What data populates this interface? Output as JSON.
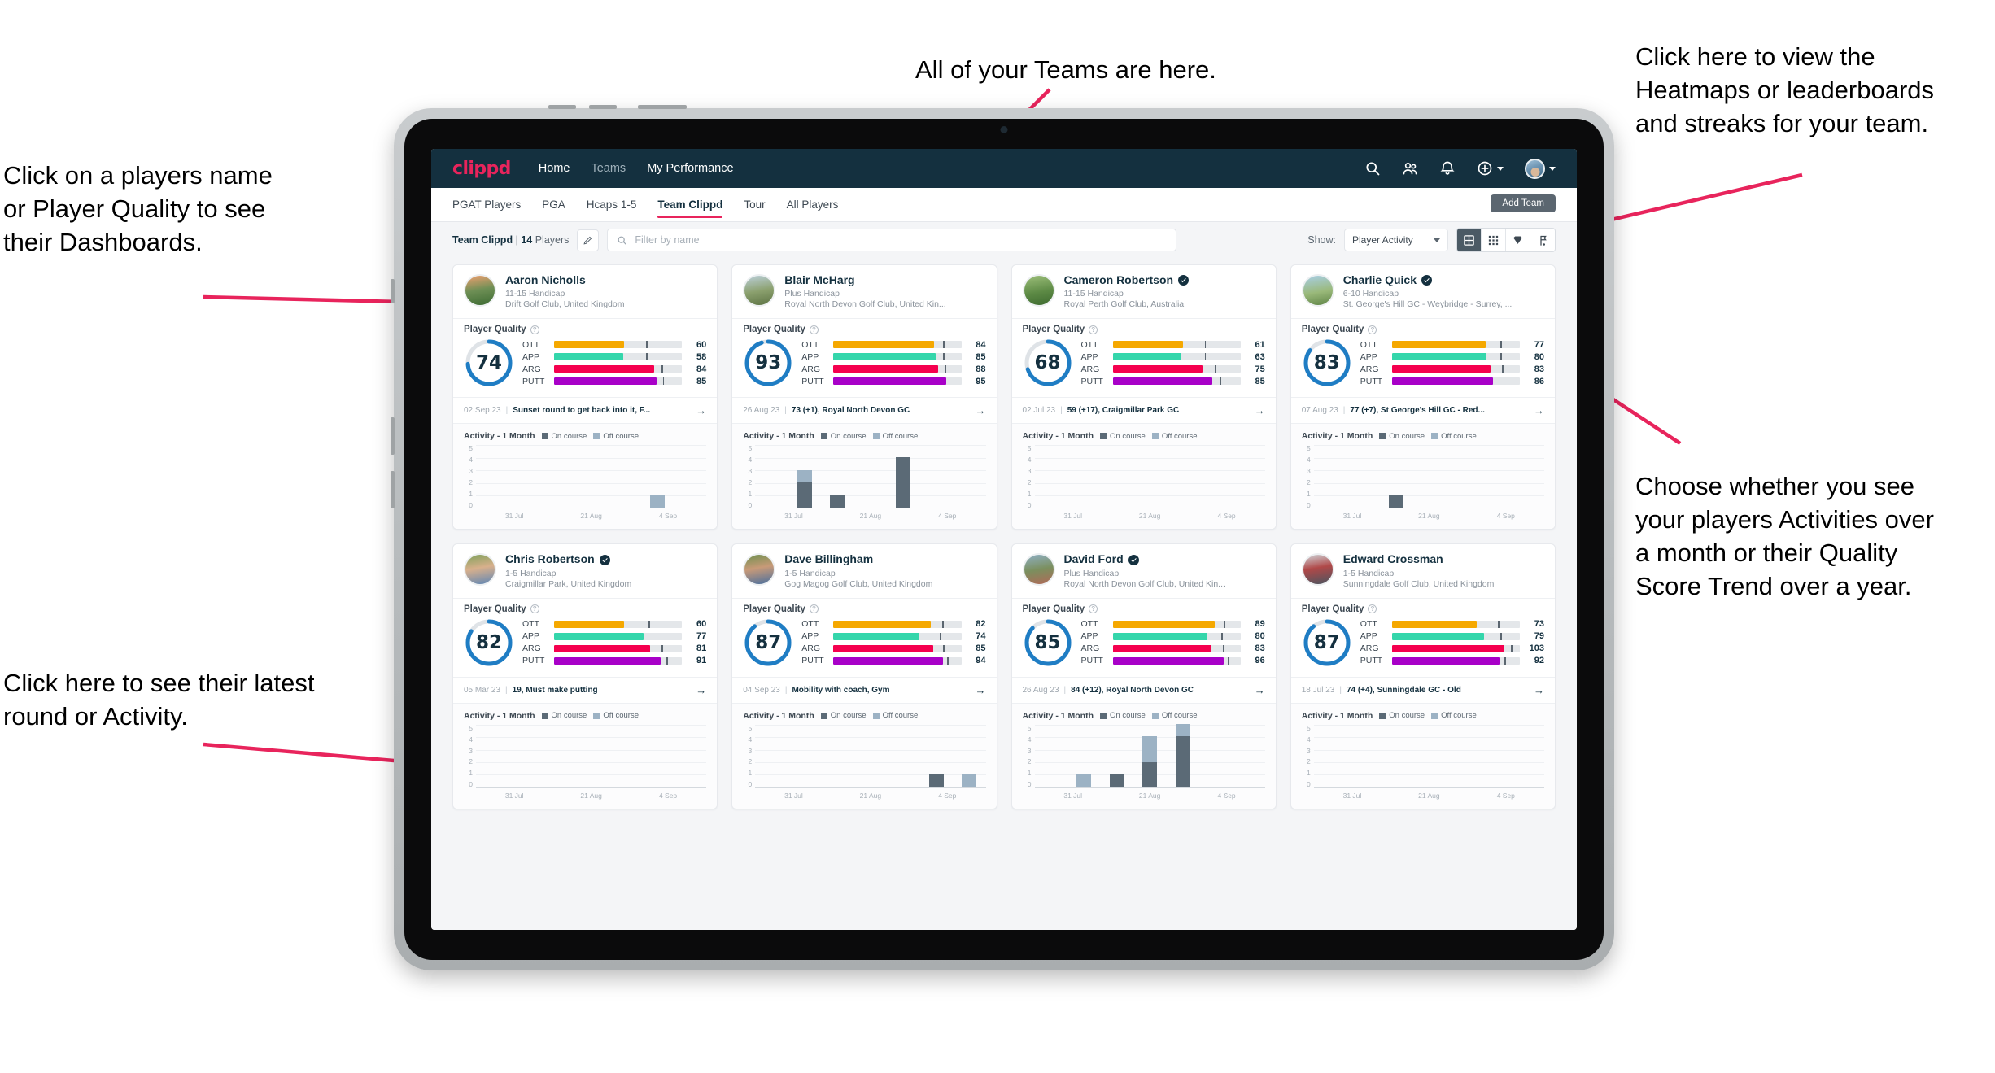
{
  "annotations": [
    {
      "id": "players-name",
      "text": "Click on a players name\nor Player Quality to see\ntheir Dashboards."
    },
    {
      "id": "teams",
      "text": "All of your Teams are here."
    },
    {
      "id": "heatmaps",
      "text": "Click here to view the\nHeatmaps or leaderboards\nand streaks for your team."
    },
    {
      "id": "activity-choice",
      "text": "Choose whether you see\nyour players Activities over\na month or their Quality\nScore Trend over a year."
    },
    {
      "id": "latest-round",
      "text": "Click here to see their latest\nround or Activity."
    }
  ],
  "colors": {
    "accent_pink": "#e8245c",
    "navy": "#14303f",
    "ring_blue": "#1f7dc4",
    "ott": "#f5a800",
    "app": "#34d6ab",
    "arg": "#f5004f",
    "putt": "#a800c8",
    "on_course": "#5b6a76",
    "off_course": "#9cb2c4"
  },
  "navbar": {
    "logo": "clippd",
    "links": [
      {
        "label": "Home",
        "active": true
      },
      {
        "label": "Teams",
        "active": false
      },
      {
        "label": "My Performance",
        "active": true
      }
    ],
    "icons": [
      "search-icon",
      "people-icon",
      "bell-icon",
      "plus-circle-icon",
      "avatar"
    ]
  },
  "tabs": {
    "items": [
      "PGAT Players",
      "PGA",
      "Hcaps 1-5",
      "Team Clippd",
      "Tour",
      "All Players"
    ],
    "active": "Team Clippd",
    "add_team_label": "Add Team"
  },
  "filterbar": {
    "team_name": "Team Clippd",
    "separator": "|",
    "player_count": "14",
    "players_word": "Players",
    "edit_icon": "pencil-icon",
    "search_placeholder": "Filter by name",
    "show_label": "Show:",
    "select_value": "Player Activity",
    "view_toggles": [
      {
        "name": "large-grid-view",
        "active": true
      },
      {
        "name": "small-grid-view",
        "active": false
      },
      {
        "name": "heatmap-view",
        "active": false
      },
      {
        "name": "leaderboard-view",
        "active": false
      }
    ]
  },
  "card_labels": {
    "player_quality": "Player Quality",
    "activity": "Activity - 1 Month",
    "on_course": "On course",
    "off_course": "Off course",
    "metrics": [
      "OTT",
      "APP",
      "ARG",
      "PUTT"
    ]
  },
  "chart_data": {
    "type": "bar",
    "title": "Activity - 1 Month",
    "ylim": [
      0,
      5
    ],
    "yticks": [
      5,
      4,
      3,
      2,
      1,
      0
    ],
    "xticks": [
      "31 Jul",
      "21 Aug",
      "4 Sep"
    ],
    "legend": [
      "On course",
      "Off course"
    ],
    "legend_position": "top",
    "grid": true,
    "series_per_player": true
  },
  "players": [
    {
      "name": "Aaron Nicholls",
      "verified": false,
      "handicap": "11-15 Handicap",
      "club": "Drift Golf Club, United Kingdom",
      "quality": 74,
      "ring_pct": 74,
      "avatar": "sunset-fairway",
      "metrics": [
        {
          "label": "OTT",
          "value": 60,
          "fill": 55,
          "mark": 72
        },
        {
          "label": "APP",
          "value": 58,
          "fill": 54,
          "mark": 72
        },
        {
          "label": "ARG",
          "value": 84,
          "fill": 78,
          "mark": 84
        },
        {
          "label": "PUTT",
          "value": 85,
          "fill": 80,
          "mark": 85
        }
      ],
      "last_date": "02 Sep 23",
      "last_text": "Sunset round to get back into it, F...",
      "bars": [
        {
          "on": 0,
          "off": 0
        },
        {
          "on": 0,
          "off": 0
        },
        {
          "on": 0,
          "off": 0
        },
        {
          "on": 0,
          "off": 0
        },
        {
          "on": 0,
          "off": 0
        },
        {
          "on": 0,
          "off": 1
        },
        {
          "on": 0,
          "off": 0
        }
      ]
    },
    {
      "name": "Blair McHarg",
      "verified": false,
      "handicap": "Plus Handicap",
      "club": "Royal North Devon Golf Club, United Kin...",
      "quality": 93,
      "ring_pct": 95,
      "avatar": "links-dunes",
      "metrics": [
        {
          "label": "OTT",
          "value": 84,
          "fill": 79,
          "mark": 86
        },
        {
          "label": "APP",
          "value": 85,
          "fill": 80,
          "mark": 86
        },
        {
          "label": "ARG",
          "value": 88,
          "fill": 82,
          "mark": 87
        },
        {
          "label": "PUTT",
          "value": 95,
          "fill": 88,
          "mark": 90
        }
      ],
      "last_date": "26 Aug 23",
      "last_text": "73 (+1), Royal North Devon GC",
      "bars": [
        {
          "on": 0,
          "off": 0
        },
        {
          "on": 2,
          "off": 1
        },
        {
          "on": 1,
          "off": 0
        },
        {
          "on": 0,
          "off": 0
        },
        {
          "on": 4,
          "off": 0
        },
        {
          "on": 0,
          "off": 0
        },
        {
          "on": 0,
          "off": 0
        }
      ]
    },
    {
      "name": "Cameron Robertson",
      "verified": true,
      "handicap": "11-15 Handicap",
      "club": "Royal Perth Golf Club, Australia",
      "quality": 68,
      "ring_pct": 70,
      "avatar": "green-fairway",
      "metrics": [
        {
          "label": "OTT",
          "value": 61,
          "fill": 55,
          "mark": 72
        },
        {
          "label": "APP",
          "value": 63,
          "fill": 54,
          "mark": 72
        },
        {
          "label": "ARG",
          "value": 75,
          "fill": 70,
          "mark": 80
        },
        {
          "label": "PUTT",
          "value": 85,
          "fill": 78,
          "mark": 84
        }
      ],
      "last_date": "02 Jul 23",
      "last_text": "59 (+17), Craigmillar Park GC",
      "bars": [
        {
          "on": 0,
          "off": 0
        },
        {
          "on": 0,
          "off": 0
        },
        {
          "on": 0,
          "off": 0
        },
        {
          "on": 0,
          "off": 0
        },
        {
          "on": 0,
          "off": 0
        },
        {
          "on": 0,
          "off": 0
        },
        {
          "on": 0,
          "off": 0
        }
      ]
    },
    {
      "name": "Charlie Quick",
      "verified": true,
      "handicap": "6-10 Handicap",
      "club": "St. George's Hill GC - Weybridge - Surrey, ...",
      "quality": 83,
      "ring_pct": 85,
      "avatar": "bunker-view",
      "metrics": [
        {
          "label": "OTT",
          "value": 77,
          "fill": 73,
          "mark": 85
        },
        {
          "label": "APP",
          "value": 80,
          "fill": 74,
          "mark": 85
        },
        {
          "label": "ARG",
          "value": 83,
          "fill": 77,
          "mark": 86
        },
        {
          "label": "PUTT",
          "value": 86,
          "fill": 79,
          "mark": 87
        }
      ],
      "last_date": "07 Aug 23",
      "last_text": "77 (+7), St George's Hill GC - Red...",
      "bars": [
        {
          "on": 0,
          "off": 0
        },
        {
          "on": 0,
          "off": 0
        },
        {
          "on": 1,
          "off": 0
        },
        {
          "on": 0,
          "off": 0
        },
        {
          "on": 0,
          "off": 0
        },
        {
          "on": 0,
          "off": 0
        },
        {
          "on": 0,
          "off": 0
        }
      ]
    },
    {
      "name": "Chris Robertson",
      "verified": true,
      "handicap": "1-5 Handicap",
      "club": "Craigmillar Park, United Kingdom",
      "quality": 82,
      "ring_pct": 84,
      "avatar": "portrait-blue-shirt",
      "metrics": [
        {
          "label": "OTT",
          "value": 60,
          "fill": 55,
          "mark": 74
        },
        {
          "label": "APP",
          "value": 77,
          "fill": 70,
          "mark": 83
        },
        {
          "label": "ARG",
          "value": 81,
          "fill": 75,
          "mark": 84
        },
        {
          "label": "PUTT",
          "value": 91,
          "fill": 83,
          "mark": 88
        }
      ],
      "last_date": "05 Mar 23",
      "last_text": "19, Must make putting",
      "bars": [
        {
          "on": 0,
          "off": 0
        },
        {
          "on": 0,
          "off": 0
        },
        {
          "on": 0,
          "off": 0
        },
        {
          "on": 0,
          "off": 0
        },
        {
          "on": 0,
          "off": 0
        },
        {
          "on": 0,
          "off": 0
        },
        {
          "on": 0,
          "off": 0
        }
      ]
    },
    {
      "name": "Dave Billingham",
      "verified": false,
      "handicap": "1-5 Handicap",
      "club": "Gog Magog Golf Club, United Kingdom",
      "quality": 87,
      "ring_pct": 89,
      "avatar": "portrait-beard",
      "metrics": [
        {
          "label": "OTT",
          "value": 82,
          "fill": 76,
          "mark": 85
        },
        {
          "label": "APP",
          "value": 74,
          "fill": 67,
          "mark": 83
        },
        {
          "label": "ARG",
          "value": 85,
          "fill": 78,
          "mark": 86
        },
        {
          "label": "PUTT",
          "value": 94,
          "fill": 86,
          "mark": 89
        }
      ],
      "last_date": "04 Sep 23",
      "last_text": "Mobility with coach, Gym",
      "bars": [
        {
          "on": 0,
          "off": 0
        },
        {
          "on": 0,
          "off": 0
        },
        {
          "on": 0,
          "off": 0
        },
        {
          "on": 0,
          "off": 0
        },
        {
          "on": 0,
          "off": 0
        },
        {
          "on": 1,
          "off": 0
        },
        {
          "on": 0,
          "off": 1
        }
      ]
    },
    {
      "name": "David Ford",
      "verified": true,
      "handicap": "Plus Handicap",
      "club": "Royal North Devon Golf Club, United Kin...",
      "quality": 85,
      "ring_pct": 87,
      "avatar": "coastal-walk",
      "metrics": [
        {
          "label": "OTT",
          "value": 89,
          "fill": 80,
          "mark": 87
        },
        {
          "label": "APP",
          "value": 80,
          "fill": 74,
          "mark": 85
        },
        {
          "label": "ARG",
          "value": 83,
          "fill": 77,
          "mark": 86
        },
        {
          "label": "PUTT",
          "value": 96,
          "fill": 87,
          "mark": 90
        }
      ],
      "last_date": "26 Aug 23",
      "last_text": "84 (+12), Royal North Devon GC",
      "bars": [
        {
          "on": 0,
          "off": 0
        },
        {
          "on": 0,
          "off": 1
        },
        {
          "on": 1,
          "off": 0
        },
        {
          "on": 2,
          "off": 2
        },
        {
          "on": 4,
          "off": 1
        },
        {
          "on": 0,
          "off": 0
        },
        {
          "on": 0,
          "off": 0
        }
      ]
    },
    {
      "name": "Edward Crossman",
      "verified": false,
      "handicap": "1-5 Handicap",
      "club": "Sunningdale Golf Club, United Kingdom",
      "quality": 87,
      "ring_pct": 89,
      "avatar": "clubhouse-red",
      "metrics": [
        {
          "label": "OTT",
          "value": 73,
          "fill": 66,
          "mark": 83
        },
        {
          "label": "APP",
          "value": 79,
          "fill": 72,
          "mark": 85
        },
        {
          "label": "ARG",
          "value": 103,
          "fill": 88,
          "mark": 93
        },
        {
          "label": "PUTT",
          "value": 92,
          "fill": 84,
          "mark": 88
        }
      ],
      "last_date": "18 Jul 23",
      "last_text": "74 (+4), Sunningdale GC - Old",
      "bars": [
        {
          "on": 0,
          "off": 0
        },
        {
          "on": 0,
          "off": 0
        },
        {
          "on": 0,
          "off": 0
        },
        {
          "on": 0,
          "off": 0
        },
        {
          "on": 0,
          "off": 0
        },
        {
          "on": 0,
          "off": 0
        },
        {
          "on": 0,
          "off": 0
        }
      ]
    }
  ]
}
